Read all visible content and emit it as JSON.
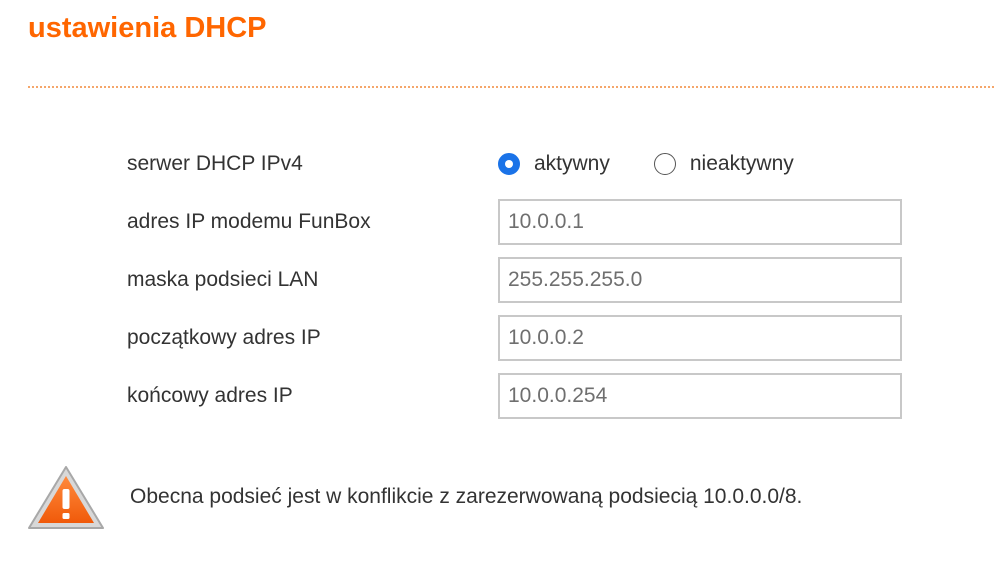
{
  "page": {
    "title": "ustawienia DHCP"
  },
  "colors": {
    "title": "#ff6600",
    "divider": "#f5a66a",
    "radio_checked": "#1a73e8",
    "warning_icon": "#ff6a1a"
  },
  "dhcp_server": {
    "label": "serwer DHCP IPv4",
    "options": [
      {
        "label": "aktywny",
        "selected": true
      },
      {
        "label": "nieaktywny",
        "selected": false
      }
    ]
  },
  "fields": {
    "modem_ip": {
      "label": "adres IP modemu FunBox",
      "value": "10.0.0.1"
    },
    "lan_mask": {
      "label": "maska podsieci LAN",
      "value": "255.255.255.0"
    },
    "start_ip": {
      "label": "początkowy adres IP",
      "value": "10.0.0.2"
    },
    "end_ip": {
      "label": "końcowy adres IP",
      "value": "10.0.0.254"
    }
  },
  "warning": {
    "icon": "warning-triangle-icon",
    "message": "Obecna podsieć jest w konflikcie z zarezerwowaną podsiecią 10.0.0.0/8."
  }
}
